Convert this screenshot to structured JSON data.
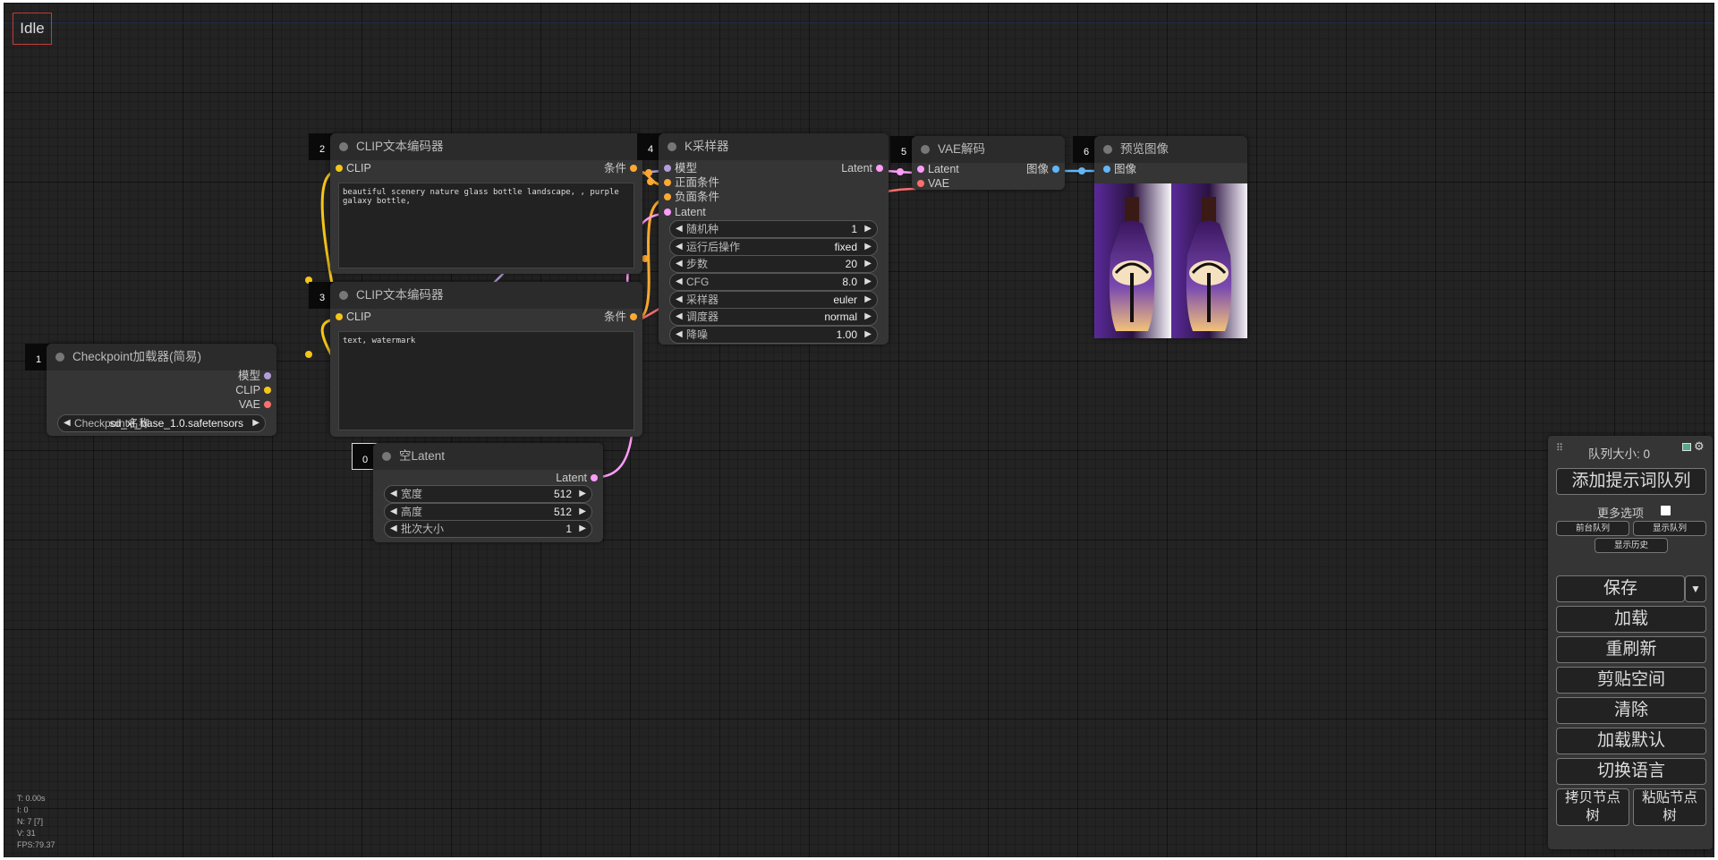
{
  "status": "Idle",
  "stats": [
    "T: 0.00s",
    "I: 0",
    "N: 7 [7]",
    "V: 31",
    "FPS:79.37"
  ],
  "colors": {
    "clip": "#f5c518",
    "model": "#b39ddb",
    "vae": "#ff6e6e",
    "latent": "#ff9cf9",
    "conditioning": "#ffa931",
    "image": "#64b5f6"
  },
  "nodes": {
    "checkpoint": {
      "id": "1",
      "title": "Checkpoint加载器(简易)",
      "outputs": [
        "模型",
        "CLIP",
        "VAE"
      ],
      "widget": {
        "label": "Checkpoint名称",
        "value": "sd_xl_base_1.0.safetensors"
      }
    },
    "clip_pos": {
      "id": "2",
      "title": "CLIP文本编码器",
      "input": "CLIP",
      "output": "条件",
      "text": "beautiful scenery nature glass bottle landscape, , purple galaxy bottle,"
    },
    "clip_neg": {
      "id": "3",
      "title": "CLIP文本编码器",
      "input": "CLIP",
      "output": "条件",
      "text": "text, watermark"
    },
    "ksampler": {
      "id": "4",
      "title": "K采样器",
      "inputs": [
        "模型",
        "正面条件",
        "负面条件",
        "Latent"
      ],
      "output": "Latent",
      "widgets": [
        {
          "label": "随机种",
          "value": "1"
        },
        {
          "label": "运行后操作",
          "value": "fixed"
        },
        {
          "label": "步数",
          "value": "20"
        },
        {
          "label": "CFG",
          "value": "8.0"
        },
        {
          "label": "采样器",
          "value": "euler"
        },
        {
          "label": "调度器",
          "value": "normal"
        },
        {
          "label": "降噪",
          "value": "1.00"
        }
      ]
    },
    "vae_decode": {
      "id": "5",
      "title": "VAE解码",
      "inputs": [
        "Latent",
        "VAE"
      ],
      "output": "图像"
    },
    "preview": {
      "id": "6",
      "title": "预览图像",
      "input": "图像"
    },
    "empty_latent": {
      "id": "0",
      "title": "空Latent",
      "output": "Latent",
      "widgets": [
        {
          "label": "宽度",
          "value": "512"
        },
        {
          "label": "高度",
          "value": "512"
        },
        {
          "label": "批次大小",
          "value": "1"
        }
      ]
    }
  },
  "menu": {
    "queue_size": "队列大小: 0",
    "queue_prompt": "添加提示词队列",
    "extra_options": "更多选项",
    "front_queue": "前台队列",
    "view_queue": "显示队列",
    "view_history": "显示历史",
    "save": "保存",
    "save_arrow": "▼",
    "load": "加载",
    "refresh": "重刷新",
    "clipspace": "剪贴空间",
    "clear": "清除",
    "load_default": "加载默认",
    "switch_locale": "切换语言",
    "copy_nodes_1": "拷贝节点",
    "copy_nodes_2": "树",
    "paste_nodes_1": "粘贴节点",
    "paste_nodes_2": "树"
  }
}
